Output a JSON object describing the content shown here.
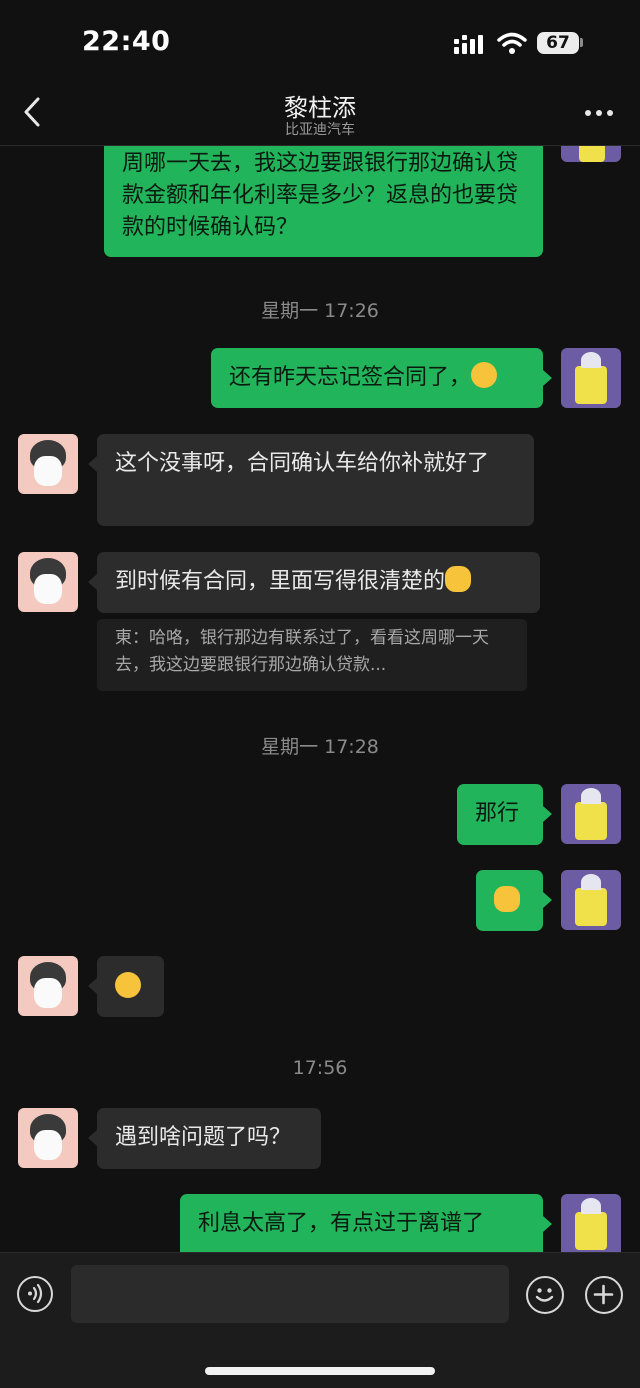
{
  "status_bar": {
    "time": "22:40",
    "battery": "67"
  },
  "header": {
    "title": "黎柱添",
    "subtitle": "比亚迪汽车"
  },
  "timestamps": [
    "星期一 17:26",
    "星期一 17:28",
    "17:56"
  ],
  "messages": [
    {
      "from": "me",
      "text": "周哪一天去，我这边要跟银行那边确认贷款金额和年化利率是多少？返息的也要贷款的时候确认码？"
    },
    {
      "from": "me",
      "text": "还有昨天忘记签合同了，"
    },
    {
      "from": "them",
      "text": "这个没事呀，合同确认车给你补就好了"
    },
    {
      "from": "them",
      "text": "到时候有合同，里面写得很清楚的"
    },
    {
      "from": "quote",
      "text": "東：哈咯，银行那边有联系过了，看看这周哪一天去，我这边要跟银行那边确认贷款..."
    },
    {
      "from": "me",
      "text": "那行"
    },
    {
      "from": "me",
      "text": ""
    },
    {
      "from": "them",
      "text": ""
    },
    {
      "from": "them",
      "text": "遇到啥问题了吗？"
    },
    {
      "from": "me",
      "text": "利息太高了，有点过于离谱了"
    }
  ],
  "icons": {
    "back": "chevron-left-icon",
    "more": "more-icon",
    "voice": "voice-icon",
    "emoji": "emoji-icon",
    "add": "plus-icon"
  },
  "colors": {
    "me_bubble": "#22b45a",
    "them_bubble": "#2c2c2c",
    "background": "#111111"
  }
}
